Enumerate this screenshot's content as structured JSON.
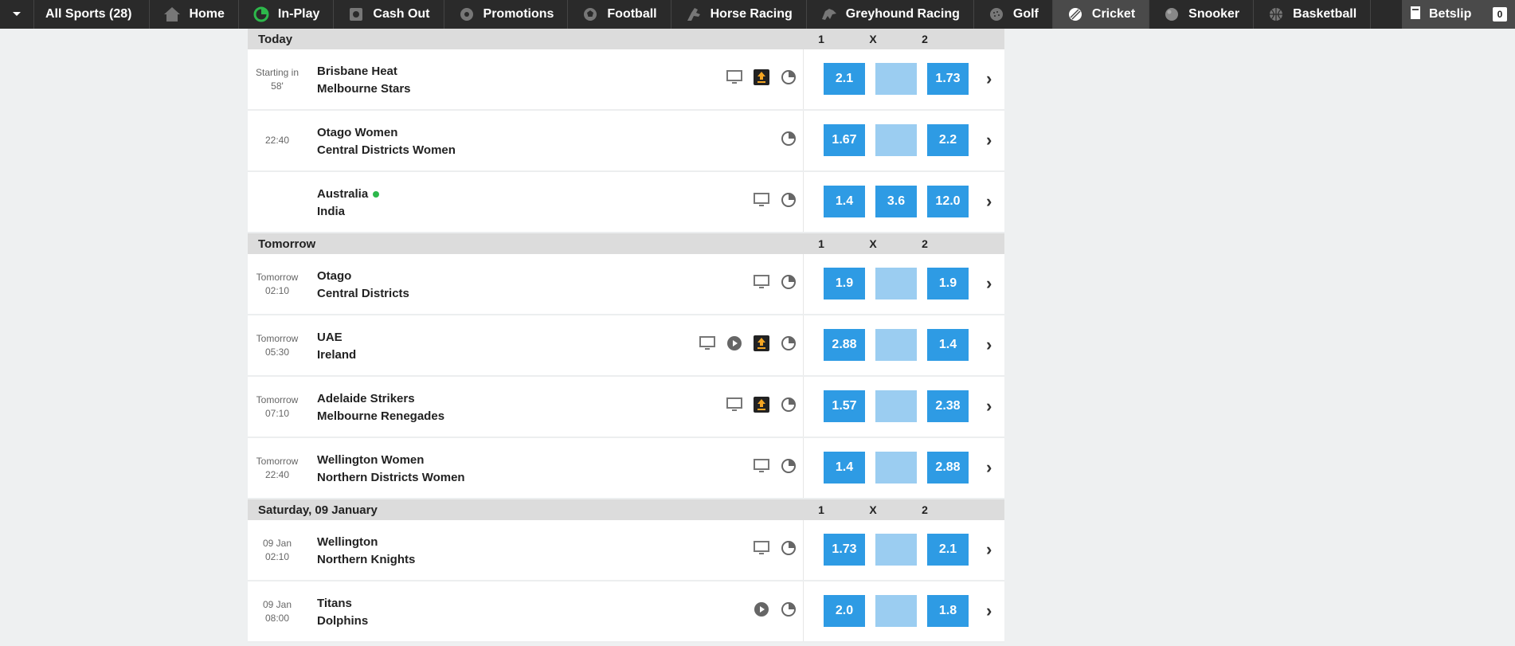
{
  "nav": {
    "items": [
      {
        "label": "All Sports (28)",
        "icon": "chevron-down-icon"
      },
      {
        "label": "Home",
        "icon": "home-icon"
      },
      {
        "label": "In-Play",
        "icon": "inplay-icon"
      },
      {
        "label": "Cash Out",
        "icon": "cashout-icon"
      },
      {
        "label": "Promotions",
        "icon": "promotions-icon"
      },
      {
        "label": "Football",
        "icon": "football-icon"
      },
      {
        "label": "Horse Racing",
        "icon": "horse-icon"
      },
      {
        "label": "Greyhound Racing",
        "icon": "greyhound-icon"
      },
      {
        "label": "Golf",
        "icon": "golf-icon"
      },
      {
        "label": "Cricket",
        "icon": "cricket-icon"
      },
      {
        "label": "Snooker",
        "icon": "snooker-icon"
      },
      {
        "label": "Basketball",
        "icon": "basketball-icon"
      }
    ],
    "active": "Cricket",
    "betslip_label": "Betslip",
    "betslip_count": "0"
  },
  "columns": {
    "c1": "1",
    "cx": "X",
    "c2": "2"
  },
  "sections": [
    {
      "title": "Today",
      "matches": [
        {
          "time1": "Starting in",
          "time2": "58'",
          "home": "Brisbane Heat",
          "away": "Melbourne Stars",
          "live": false,
          "icons": [
            "tv-icon",
            "boost-icon",
            "stats-icon"
          ],
          "odds": [
            "2.1",
            "",
            "1.73"
          ]
        },
        {
          "time1": "22:40",
          "time2": "",
          "home": "Otago Women",
          "away": "Central Districts Women",
          "live": false,
          "icons": [
            "stats-icon"
          ],
          "odds": [
            "1.67",
            "",
            "2.2"
          ]
        },
        {
          "time1": "",
          "time2": "",
          "home": "Australia",
          "away": "India",
          "live": true,
          "icons": [
            "tv-icon",
            "stats-icon"
          ],
          "odds": [
            "1.4",
            "3.6",
            "12.0"
          ]
        }
      ]
    },
    {
      "title": "Tomorrow",
      "matches": [
        {
          "time1": "Tomorrow",
          "time2": "02:10",
          "home": "Otago",
          "away": "Central Districts",
          "live": false,
          "icons": [
            "tv-icon",
            "stats-icon"
          ],
          "odds": [
            "1.9",
            "",
            "1.9"
          ]
        },
        {
          "time1": "Tomorrow",
          "time2": "05:30",
          "home": "UAE",
          "away": "Ireland",
          "live": false,
          "icons": [
            "tv-icon",
            "play-icon",
            "boost-icon",
            "stats-icon"
          ],
          "odds": [
            "2.88",
            "",
            "1.4"
          ]
        },
        {
          "time1": "Tomorrow",
          "time2": "07:10",
          "home": "Adelaide Strikers",
          "away": "Melbourne Renegades",
          "live": false,
          "icons": [
            "tv-icon",
            "boost-icon",
            "stats-icon"
          ],
          "odds": [
            "1.57",
            "",
            "2.38"
          ]
        },
        {
          "time1": "Tomorrow",
          "time2": "22:40",
          "home": "Wellington Women",
          "away": "Northern Districts Women",
          "live": false,
          "icons": [
            "tv-icon",
            "stats-icon"
          ],
          "odds": [
            "1.4",
            "",
            "2.88"
          ]
        }
      ]
    },
    {
      "title": "Saturday, 09 January",
      "matches": [
        {
          "time1": "09 Jan",
          "time2": "02:10",
          "home": "Wellington",
          "away": "Northern Knights",
          "live": false,
          "icons": [
            "tv-icon",
            "stats-icon"
          ],
          "odds": [
            "1.73",
            "",
            "2.1"
          ]
        },
        {
          "time1": "09 Jan",
          "time2": "08:00",
          "home": "Titans",
          "away": "Dolphins",
          "live": false,
          "icons": [
            "play-icon",
            "stats-icon"
          ],
          "odds": [
            "2.0",
            "",
            "1.8"
          ]
        }
      ]
    }
  ],
  "colors": {
    "odds": "#2e9be4",
    "odds_empty": "#9bcdf1",
    "nav_bg": "#2a2a2a",
    "live": "#2db84b"
  }
}
